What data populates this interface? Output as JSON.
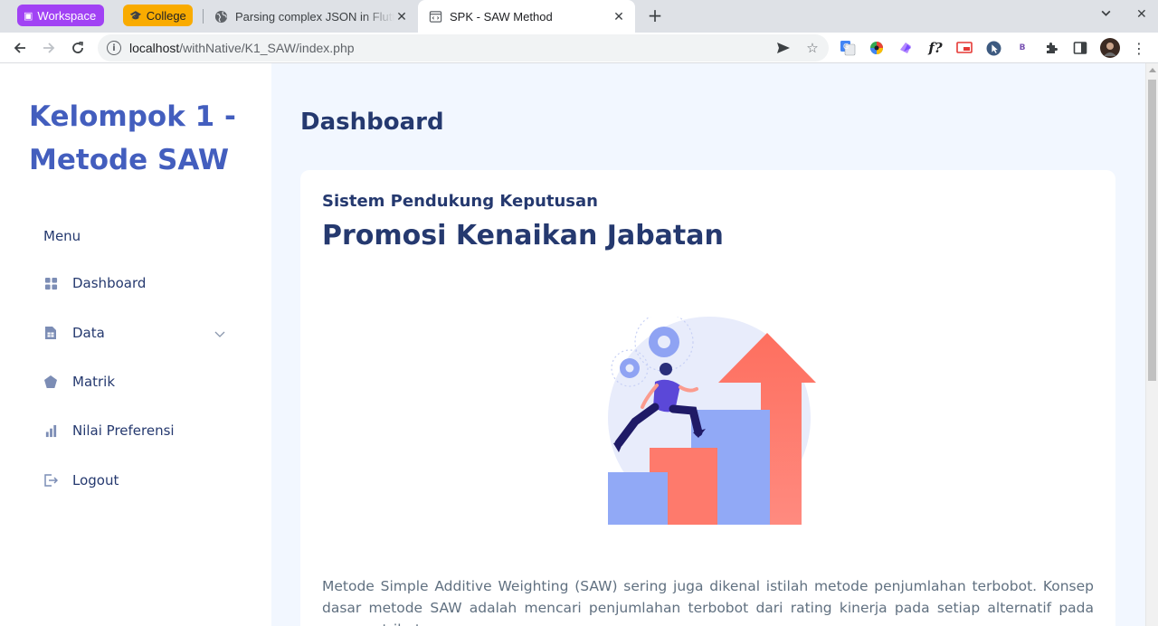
{
  "browser": {
    "tab_groups": [
      {
        "label": "Workspace",
        "color": "#a142f4"
      },
      {
        "label": "College",
        "color": "#f9ab00"
      }
    ],
    "tabs": [
      {
        "title": "Parsing complex JSON in Flutter",
        "favicon": "globe-icon",
        "active": false
      },
      {
        "title": "SPK - SAW Method",
        "favicon": "page-code-icon",
        "active": true
      }
    ],
    "url": {
      "host": "localhost",
      "path": "/withNative/K1_SAW/index.php"
    },
    "extensions": [
      "google-translate-icon",
      "color-wheel-icon",
      "extension-purple-icon",
      "formula-icon",
      "screen-cast-icon",
      "cursor-icon",
      "bootstrap-icon",
      "puzzle-icon",
      "side-panel-icon",
      "profile-avatar"
    ]
  },
  "sidebar": {
    "brand": "Kelompok 1 - Metode SAW",
    "menu_title": "Menu",
    "items": [
      {
        "label": "Dashboard",
        "icon": "grid-icon"
      },
      {
        "label": "Data",
        "icon": "file-spreadsheet-icon",
        "has_submenu": true
      },
      {
        "label": "Matrik",
        "icon": "pentagon-icon"
      },
      {
        "label": "Nilai Preferensi",
        "icon": "bar-chart-icon"
      },
      {
        "label": "Logout",
        "icon": "logout-icon"
      }
    ]
  },
  "main": {
    "heading": "Dashboard",
    "card": {
      "subtitle": "Sistem Pendukung Keputusan",
      "title": "Promosi Kenaikan Jabatan",
      "body": "Metode Simple Additive Weighting (SAW) sering juga dikenal istilah metode penjumlahan terbobot. Konsep dasar metode SAW adalah mencari penjumlahan terbobot dari rating kinerja pada setiap alternatif pada semua atribut"
    }
  },
  "colors": {
    "primary": "#435ebe",
    "heading": "#25396f",
    "background": "#f2f7ff",
    "text": "#607080"
  }
}
